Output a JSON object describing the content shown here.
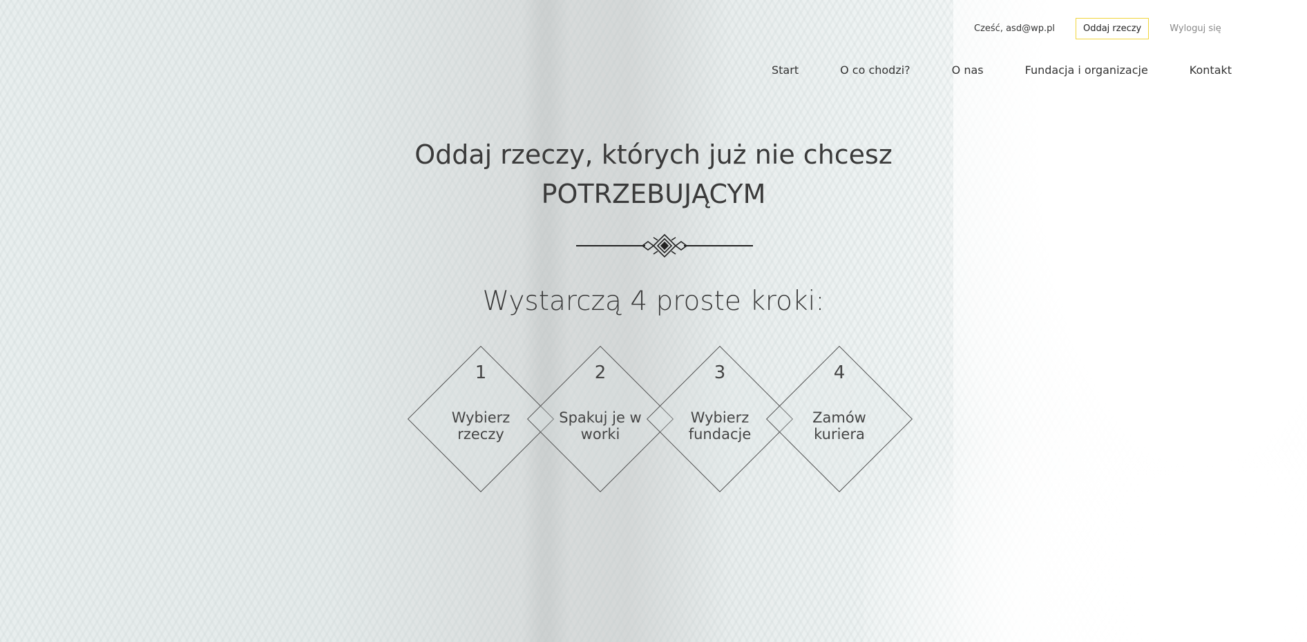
{
  "header": {
    "greeting": "Cześć, asd@wp.pl",
    "give_button": "Oddaj rzeczy",
    "logout": "Wyloguj się"
  },
  "nav": {
    "items": [
      {
        "label": "Start"
      },
      {
        "label": "O co chodzi?"
      },
      {
        "label": "O nas"
      },
      {
        "label": "Fundacja i organizacje"
      },
      {
        "label": "Kontakt"
      }
    ]
  },
  "hero": {
    "title_line1": "Oddaj rzeczy, których już nie chcesz",
    "title_line2": "POTRZEBUJĄCYM",
    "steps_title": "Wystarczą 4 proste kroki:"
  },
  "steps": [
    {
      "number": "1",
      "label": "Wybierz rzeczy"
    },
    {
      "number": "2",
      "label": "Spakuj je w worki"
    },
    {
      "number": "3",
      "label": "Wybierz fundacje"
    },
    {
      "number": "4",
      "label": "Zamów kuriera"
    }
  ],
  "colors": {
    "accent_border": "#f0d43a",
    "text": "#3a3a3a",
    "muted": "#888888"
  }
}
